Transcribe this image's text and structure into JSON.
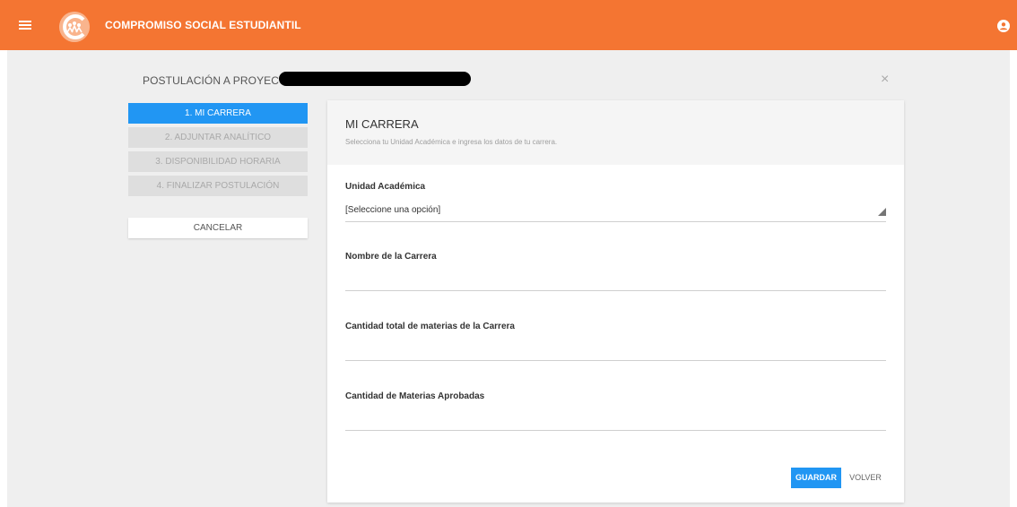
{
  "app": {
    "title": "COMPROMISO SOCIAL ESTUDIANTIL",
    "icons": {
      "menu": "menu-icon",
      "logo": "logo-icon",
      "account": "account-circle-icon",
      "close": "close-icon",
      "dropdown": "dropdown-arrow-icon"
    }
  },
  "colors": {
    "header": "#f47532",
    "primary": "#2196f3",
    "background": "#efefef"
  },
  "page": {
    "heading": "POSTULACIÓN A PROYECTO:",
    "close_symbol": "×"
  },
  "steps": [
    {
      "label": "1. MI CARRERA",
      "state": "active"
    },
    {
      "label": "2. ADJUNTAR ANALÍTICO",
      "state": "disabled"
    },
    {
      "label": "3. DISPONIBILIDAD HORARIA",
      "state": "disabled"
    },
    {
      "label": "4. FINALIZAR POSTULACIÓN",
      "state": "disabled"
    }
  ],
  "cancel_label": "CANCELAR",
  "form": {
    "title": "MI CARRERA",
    "subtitle": "Selecciona tu Unidad Académica e ingresa los datos de tu carrera.",
    "fields": [
      {
        "label": "Unidad Académica",
        "type": "select",
        "value": "[Seleccione una opción]"
      },
      {
        "label": "Nombre de la Carrera",
        "type": "text",
        "value": ""
      },
      {
        "label": "Cantidad total de materias de la Carrera",
        "type": "text",
        "value": ""
      },
      {
        "label": "Cantidad de Materias Aprobadas",
        "type": "text",
        "value": ""
      }
    ],
    "save_label": "GUARDAR",
    "back_label": "VOLVER"
  }
}
